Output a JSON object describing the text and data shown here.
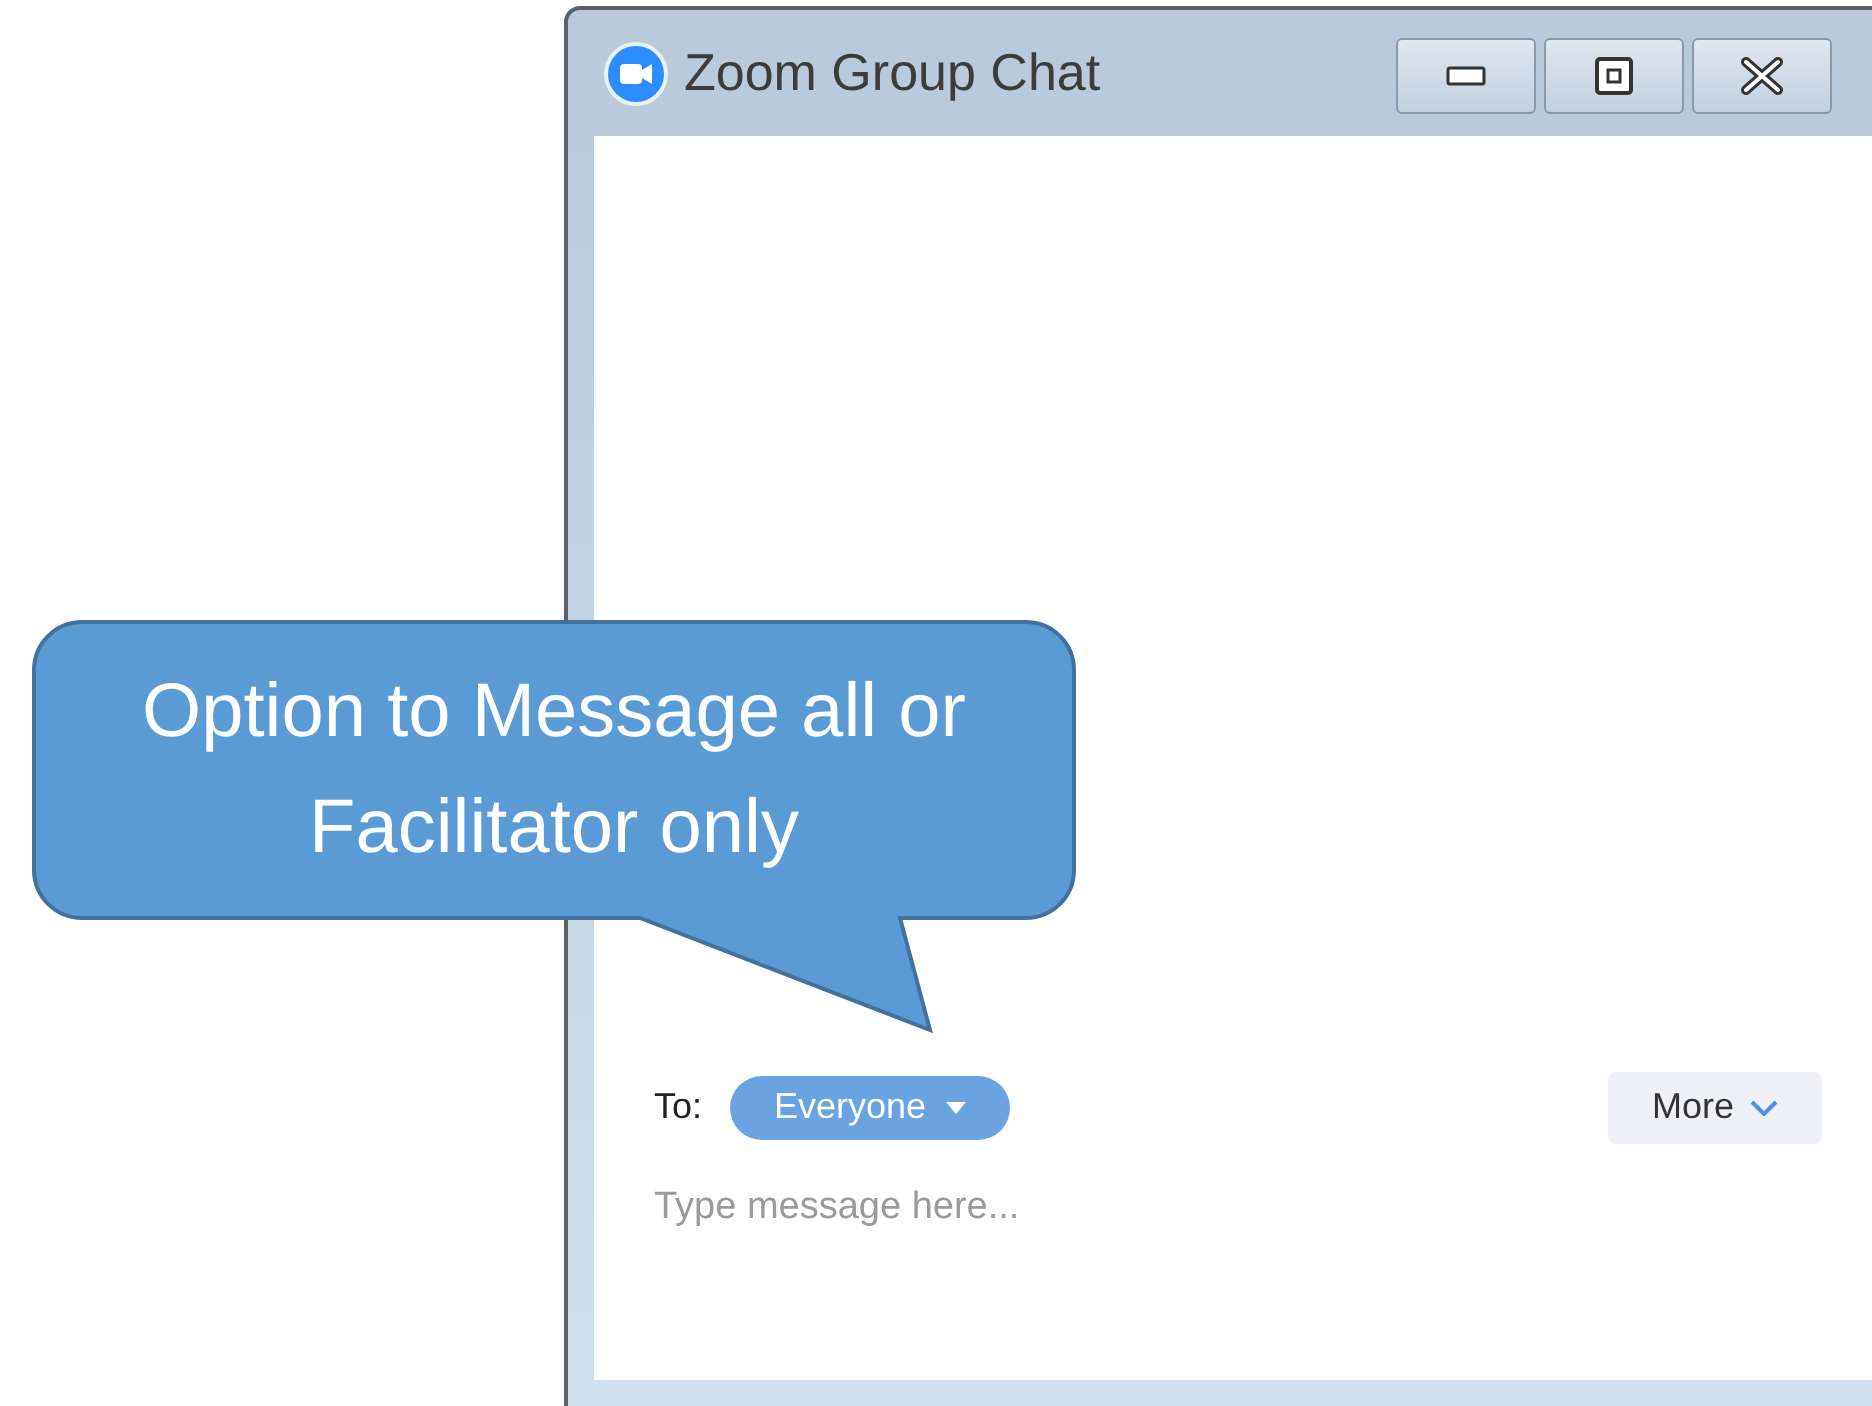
{
  "window": {
    "title": "Zoom Group Chat"
  },
  "composer": {
    "to_label": "To:",
    "recipient": "Everyone",
    "more": "More",
    "placeholder": "Type message here..."
  },
  "callout": {
    "text": "Option to Message all or Facilitator only"
  }
}
